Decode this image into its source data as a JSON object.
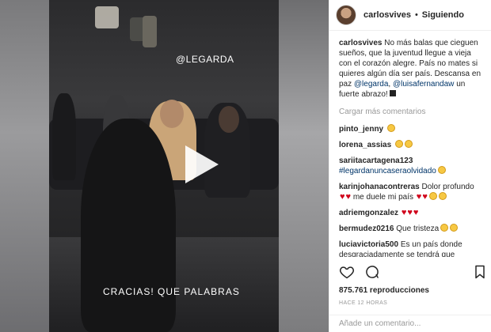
{
  "video": {
    "watermark": "@LEGARDA",
    "overlay_caption": "CRACIAS! QUE PALABRAS"
  },
  "header": {
    "username": "carlosvives",
    "separator": "•",
    "follow_status": "Siguiendo"
  },
  "caption": {
    "username": "carlosvives",
    "text": "No más balas que cieguen sueños, que la juventud llegue a vieja con el corazón alegre. País no mates si quieres algún día ser país. Descansa en paz",
    "mention1": "@legarda",
    "comma": ",",
    "mention2": "@luisafernandaw",
    "tail": "un fuerte abrazo!"
  },
  "load_more": "Cargar más comentarios",
  "comments": [
    {
      "user": "pinto_jenny",
      "text": ""
    },
    {
      "user": "lorena_assias",
      "text": ""
    },
    {
      "user": "sariitacartagena123",
      "text": "#legardanuncaseraolvidado"
    },
    {
      "user": "karinjohanacontreras",
      "text": "Dolor profundo",
      "text2": "me duele mi país"
    },
    {
      "user": "adriemgonzalez",
      "text": ""
    },
    {
      "user": "bermudez0216",
      "text": "Que tristeza"
    },
    {
      "user": "luciavictoria500",
      "text": "Es un país donde desgraciadamente se tendrá que"
    }
  ],
  "stats": {
    "views": "875.761 reproducciones",
    "time": "HACE 12 HORAS"
  },
  "add_comment": {
    "placeholder": "Añade un comentario..."
  },
  "icons": {
    "like": "heart-icon",
    "comment": "comment-icon",
    "save": "bookmark-icon",
    "play": "play-icon"
  }
}
